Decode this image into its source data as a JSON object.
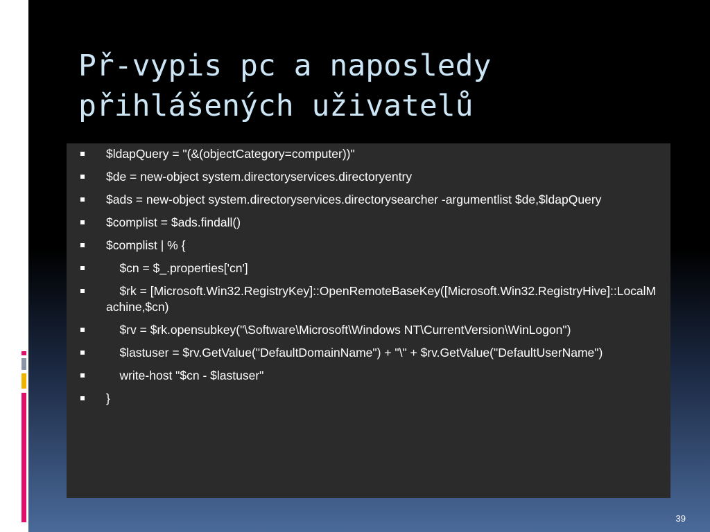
{
  "slide": {
    "title": "Př-vypis pc a naposledy\npřihlášených uživatelů",
    "page_number": "39",
    "colors": {
      "title": "#cce6f6",
      "content_background": "#2b2b2b",
      "accent_pink": "#e0106a",
      "accent_yellow": "#f0b400"
    }
  },
  "code_lines": [
    "$ldapQuery = \"(&(objectCategory=computer))\"",
    "$de = new-object system.directoryservices.directoryentry",
    "$ads = new-object system.directoryservices.directorysearcher -argumentlist $de,$ldapQuery",
    "$complist = $ads.findall()",
    "$complist | % {",
    "    $cn = $_.properties['cn']",
    "    $rk = [Microsoft.Win32.RegistryKey]::OpenRemoteBaseKey([Microsoft.Win32.RegistryHive]::LocalMachine,$cn)",
    "    $rv = $rk.opensubkey(\"\\Software\\Microsoft\\Windows NT\\CurrentVersion\\WinLogon\")",
    "    $lastuser = $rv.GetValue(\"DefaultDomainName\") + \"\\\" + $rv.GetValue(\"DefaultUserName\")",
    "    write-host \"$cn - $lastuser\"",
    "}"
  ]
}
